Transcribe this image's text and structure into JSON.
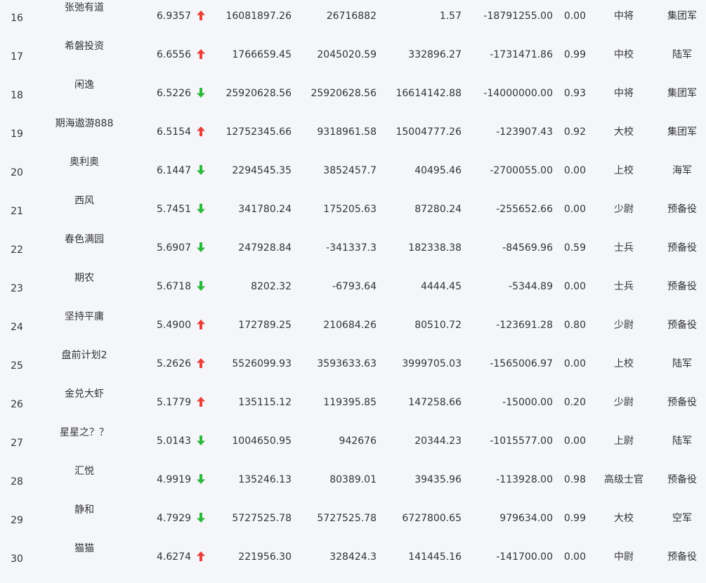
{
  "colors": {
    "background": "#f4f6f9",
    "text": "#333333",
    "up": "#e8403a",
    "down": "#2db83d"
  },
  "rows": [
    {
      "rank": "16",
      "name": "张弛有道",
      "score": "6.9357",
      "trend": "up",
      "v1": "16081897.26",
      "v2": "26716882",
      "v3": "1.57",
      "v4": "-18791255.00",
      "v5": "0.00",
      "rankTitle": "中将",
      "branch": "集团军"
    },
    {
      "rank": "17",
      "name": "希磐投资",
      "score": "6.6556",
      "trend": "up",
      "v1": "1766659.45",
      "v2": "2045020.59",
      "v3": "332896.27",
      "v4": "-1731471.86",
      "v5": "0.99",
      "rankTitle": "中校",
      "branch": "陆军"
    },
    {
      "rank": "18",
      "name": "闲逸",
      "score": "6.5226",
      "trend": "down",
      "v1": "25920628.56",
      "v2": "25920628.56",
      "v3": "16614142.88",
      "v4": "-14000000.00",
      "v5": "0.93",
      "rankTitle": "中将",
      "branch": "集团军"
    },
    {
      "rank": "19",
      "name": "期海遨游888",
      "score": "6.5154",
      "trend": "up",
      "v1": "12752345.66",
      "v2": "9318961.58",
      "v3": "15004777.26",
      "v4": "-123907.43",
      "v5": "0.92",
      "rankTitle": "大校",
      "branch": "集团军"
    },
    {
      "rank": "20",
      "name": "奥利奥",
      "score": "6.1447",
      "trend": "down",
      "v1": "2294545.35",
      "v2": "3852457.7",
      "v3": "40495.46",
      "v4": "-2700055.00",
      "v5": "0.00",
      "rankTitle": "上校",
      "branch": "海军"
    },
    {
      "rank": "21",
      "name": "西风",
      "score": "5.7451",
      "trend": "down",
      "v1": "341780.24",
      "v2": "175205.63",
      "v3": "87280.24",
      "v4": "-255652.66",
      "v5": "0.00",
      "rankTitle": "少尉",
      "branch": "预备役"
    },
    {
      "rank": "22",
      "name": "春色满园",
      "score": "5.6907",
      "trend": "down",
      "v1": "247928.84",
      "v2": "-341337.3",
      "v3": "182338.38",
      "v4": "-84569.96",
      "v5": "0.59",
      "rankTitle": "士兵",
      "branch": "预备役"
    },
    {
      "rank": "23",
      "name": "期农",
      "score": "5.6718",
      "trend": "down",
      "v1": "8202.32",
      "v2": "-6793.64",
      "v3": "4444.45",
      "v4": "-5344.89",
      "v5": "0.00",
      "rankTitle": "士兵",
      "branch": "预备役"
    },
    {
      "rank": "24",
      "name": "坚持平庸",
      "score": "5.4900",
      "trend": "up",
      "v1": "172789.25",
      "v2": "210684.26",
      "v3": "80510.72",
      "v4": "-123691.28",
      "v5": "0.80",
      "rankTitle": "少尉",
      "branch": "预备役"
    },
    {
      "rank": "25",
      "name": "盘前计划2",
      "score": "5.2626",
      "trend": "up",
      "v1": "5526099.93",
      "v2": "3593633.63",
      "v3": "3999705.03",
      "v4": "-1565006.97",
      "v5": "0.00",
      "rankTitle": "上校",
      "branch": "陆军"
    },
    {
      "rank": "26",
      "name": "金兑大虾",
      "score": "5.1779",
      "trend": "up",
      "v1": "135115.12",
      "v2": "119395.85",
      "v3": "147258.66",
      "v4": "-15000.00",
      "v5": "0.20",
      "rankTitle": "少尉",
      "branch": "预备役"
    },
    {
      "rank": "27",
      "name": "星星之？？",
      "score": "5.0143",
      "trend": "down",
      "v1": "1004650.95",
      "v2": "942676",
      "v3": "20344.23",
      "v4": "-1015577.00",
      "v5": "0.00",
      "rankTitle": "上尉",
      "branch": "陆军"
    },
    {
      "rank": "28",
      "name": "汇悦",
      "score": "4.9919",
      "trend": "down",
      "v1": "135246.13",
      "v2": "80389.01",
      "v3": "39435.96",
      "v4": "-113928.00",
      "v5": "0.98",
      "rankTitle": "高级士官",
      "branch": "预备役"
    },
    {
      "rank": "29",
      "name": "静和",
      "score": "4.7929",
      "trend": "down",
      "v1": "5727525.78",
      "v2": "5727525.78",
      "v3": "6727800.65",
      "v4": "979634.00",
      "v5": "0.99",
      "rankTitle": "大校",
      "branch": "空军"
    },
    {
      "rank": "30",
      "name": "猫猫",
      "score": "4.6274",
      "trend": "up",
      "v1": "221956.30",
      "v2": "328424.3",
      "v3": "141445.16",
      "v4": "-141700.00",
      "v5": "0.00",
      "rankTitle": "中尉",
      "branch": "预备役"
    }
  ]
}
